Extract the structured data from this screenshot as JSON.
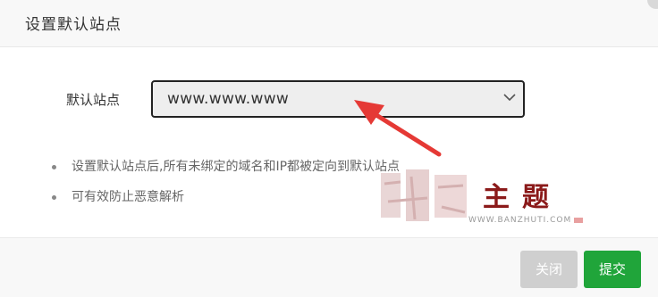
{
  "dialog": {
    "title": "设置默认站点",
    "field_label": "默认站点",
    "select": {
      "value": "www.www.www"
    },
    "tips": [
      "设置默认站点后,所有未绑定的域名和IP都被定向到默认站点",
      "可有效防止恶意解析"
    ],
    "buttons": {
      "close_label": "关闭",
      "submit_label": "提交"
    }
  },
  "watermark": {
    "text": "主题",
    "url": "WWW.BANZHUTI.COM"
  },
  "colors": {
    "accent_green": "#20a53a",
    "arrow_red": "#e53935",
    "header_bg": "#f8f8f8"
  }
}
